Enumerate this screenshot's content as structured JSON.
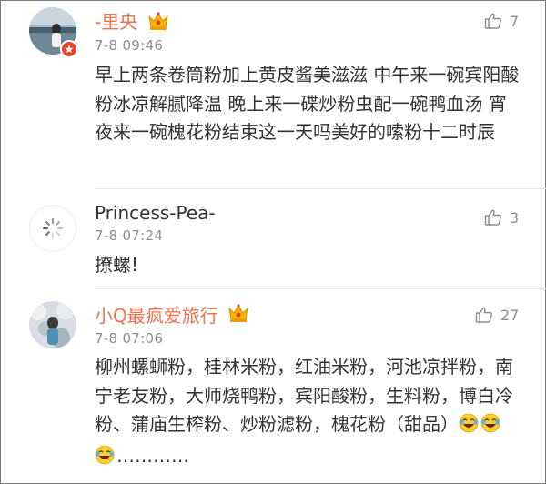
{
  "comments": [
    {
      "username": "-里央",
      "timestamp": "7-8 09:46",
      "likes": "7",
      "text": "早上两条卷筒粉加上黄皮酱美滋滋 中午来一碗宾阳酸粉冰凉解腻降温 晚上来一碟炒粉虫配一碗鸭血汤 宵夜来一碗槐花粉结束这一天吗美好的嗦粉十二时辰",
      "badge": "crown-icon",
      "verified": true
    },
    {
      "username": "Princess-Pea-",
      "timestamp": "7-8 07:24",
      "likes": "3",
      "text": "撩螺!",
      "badge": null,
      "avatar": "loading-spinner"
    },
    {
      "username": "小Q最疯爱旅行",
      "timestamp": "7-8 07:06",
      "likes": "27",
      "text": "柳州螺蛳粉，桂林米粉，红油米粉，河池凉拌粉，南宁老友粉，大师烧鸭粉，宾阳酸粉，生料粉，博白冷粉、蒲庙生榨粉、炒粉滤粉，槐花粉（甜品）",
      "text_tail": "…………",
      "emojis": [
        "laughing-tears-emoji",
        "laughing-tears-emoji",
        "laughing-tears-emoji"
      ],
      "badge": "crown-icon"
    }
  ],
  "colors": {
    "vip_name": "#eb7350",
    "normal_name": "#333333",
    "meta": "#8d8d8d",
    "verified_badge": "#e9442b",
    "crown": "#f7b500"
  }
}
